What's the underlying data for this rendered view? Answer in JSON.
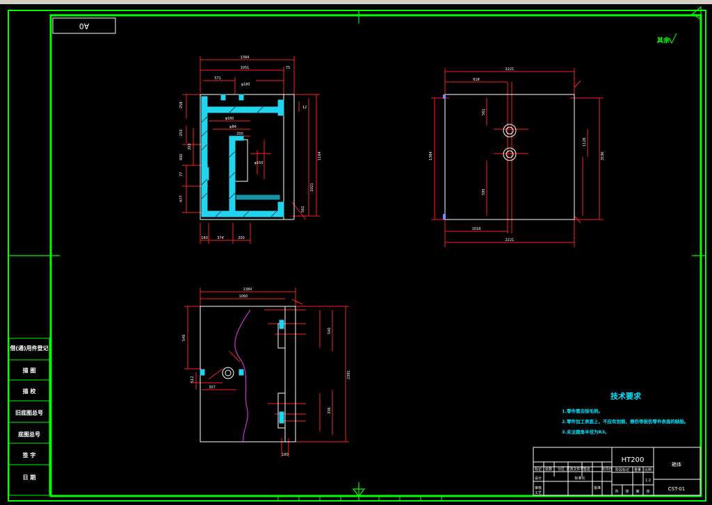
{
  "sheet": {
    "size_label": "A0",
    "roughness": "其余"
  },
  "side_labels": [
    "借(通)用件登记",
    "描 图",
    "描 校",
    "旧底图总号",
    "底图总号",
    "签 字",
    "日 期"
  ],
  "tech": {
    "title": "技术要求",
    "items": [
      "1.零件需去除毛刺。",
      "2.零件加工表面上，不应有划痕、擦伤等损伤零件表面的缺陷。",
      "3.未注圆角半径为R3。"
    ]
  },
  "title_block": {
    "material": "HT200",
    "part_name": "箱体",
    "drawing_no": "CST-01",
    "scale": "1:2",
    "headers": [
      "标记",
      "处数",
      "分区",
      "更改文件号",
      "签名",
      "年月日"
    ],
    "roles": [
      "设计",
      "审核",
      "工艺"
    ],
    "std": "标准化",
    "stage": "阶段标记",
    "weight": "重量",
    "ratio": "比例",
    "approve": "批准",
    "sheet_info": [
      "共",
      "张",
      "第",
      "张"
    ]
  },
  "dims": {
    "front_top": [
      "1384",
      "1051",
      "571",
      "φ180",
      "75"
    ],
    "front_mid": [
      "φ180",
      "φ84",
      "φ150",
      "200"
    ],
    "front_left": [
      "258",
      "253",
      "203",
      "400",
      "77",
      "477"
    ],
    "front_right": [
      "1164",
      "1021",
      "561",
      "12"
    ],
    "front_bottom": [
      "180",
      "374",
      "200"
    ],
    "side_top": [
      "2221",
      "618"
    ],
    "side_bottom": [
      "2221",
      "1018"
    ],
    "side_mid": [
      "1384",
      "3196",
      "561",
      "1128",
      "595"
    ],
    "top_top": [
      "1384",
      "1060"
    ],
    "top_right": [
      "2391",
      "540",
      "336"
    ],
    "top_left": [
      "540",
      "512",
      "307",
      "180"
    ]
  }
}
